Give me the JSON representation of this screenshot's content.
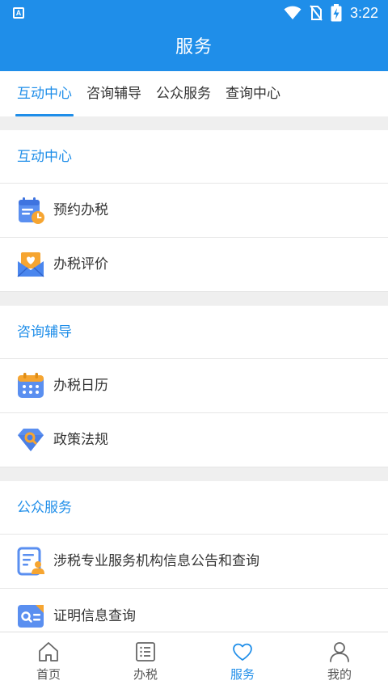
{
  "status_bar": {
    "app_indicator": "A",
    "time": "3:22"
  },
  "app_bar": {
    "title": "服务"
  },
  "tabs": [
    {
      "label": "互动中心",
      "active": true
    },
    {
      "label": "咨询辅导",
      "active": false
    },
    {
      "label": "公众服务",
      "active": false
    },
    {
      "label": "查询中心",
      "active": false
    }
  ],
  "sections": [
    {
      "title": "互动中心",
      "items": [
        {
          "label": "预约办税",
          "icon": "appointment-calendar-icon"
        },
        {
          "label": "办税评价",
          "icon": "evaluation-envelope-icon"
        }
      ]
    },
    {
      "title": "咨询辅导",
      "items": [
        {
          "label": "办税日历",
          "icon": "tax-calendar-icon"
        },
        {
          "label": "政策法规",
          "icon": "policy-diamond-icon"
        }
      ]
    },
    {
      "title": "公众服务",
      "items": [
        {
          "label": "涉税专业服务机构信息公告和查询",
          "icon": "agency-document-icon"
        },
        {
          "label": "证明信息查询",
          "icon": "certificate-search-icon"
        }
      ]
    }
  ],
  "bottom_nav": [
    {
      "label": "首页",
      "icon": "home-icon",
      "active": false
    },
    {
      "label": "办税",
      "icon": "list-icon",
      "active": false
    },
    {
      "label": "服务",
      "icon": "heart-icon",
      "active": true
    },
    {
      "label": "我的",
      "icon": "user-icon",
      "active": false
    }
  ],
  "colors": {
    "primary": "#1f8ee9",
    "divider": "#efefef",
    "text": "#333333"
  }
}
